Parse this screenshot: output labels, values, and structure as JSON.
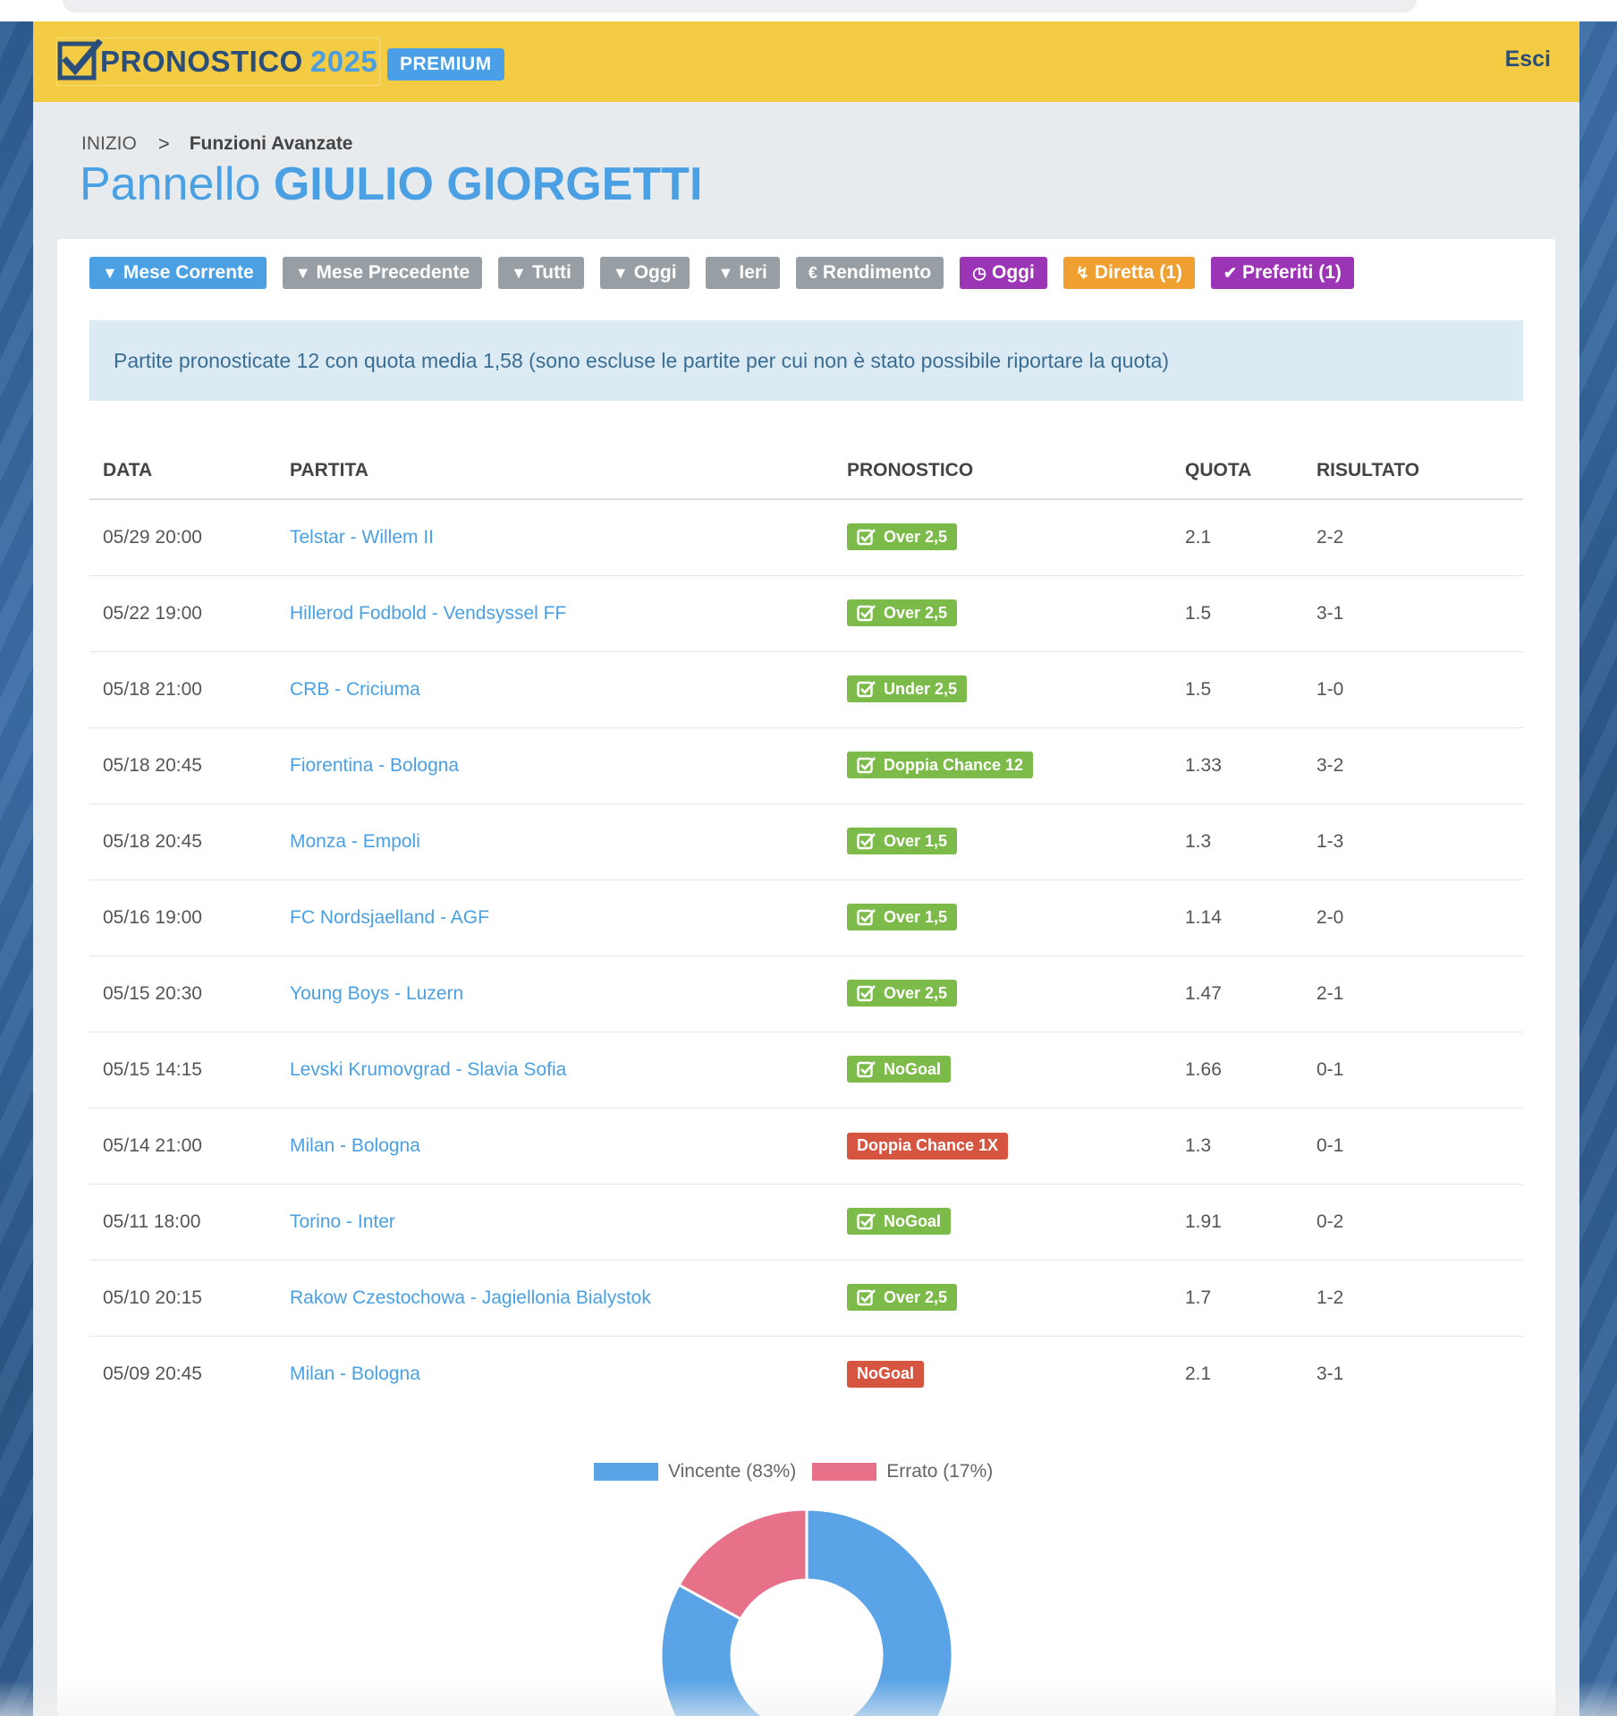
{
  "header": {
    "logo_main": "PRONOSTICO",
    "logo_year": "2025",
    "badge": "PREMIUM",
    "logout": "Esci"
  },
  "breadcrumb": {
    "home": "INIZIO",
    "separator": ">",
    "current": "Funzioni Avanzate"
  },
  "title": {
    "prefix": "Pannello",
    "name": "GIULIO GIORGETTI"
  },
  "filters": [
    {
      "label": "Mese Corrente",
      "icon": "filter-icon",
      "color": "#4aa0e3"
    },
    {
      "label": "Mese Precedente",
      "icon": "filter-icon",
      "color": "#979fa5"
    },
    {
      "label": "Tutti",
      "icon": "filter-icon",
      "color": "#979fa5"
    },
    {
      "label": "Oggi",
      "icon": "filter-icon",
      "color": "#979fa5"
    },
    {
      "label": "Ieri",
      "icon": "filter-icon",
      "color": "#979fa5"
    },
    {
      "label": "Rendimento",
      "icon": "euro-icon",
      "color": "#979fa5"
    },
    {
      "label": "Oggi",
      "icon": "clock-icon",
      "color": "#9b34b5"
    },
    {
      "label": "Diretta (1)",
      "icon": "bolt-icon",
      "color": "#f0a030"
    },
    {
      "label": "Preferiti (1)",
      "icon": "check-icon",
      "color": "#9b34b5"
    }
  ],
  "info": "Partite pronosticate 12 con quota media 1,58 (sono escluse le partite per cui non è stato possibile riportare la quota)",
  "table": {
    "headers": [
      "DATA",
      "PARTITA",
      "PRONOSTICO",
      "QUOTA",
      "RISULTATO"
    ],
    "rows": [
      {
        "date": "05/29 20:00",
        "match": "Telstar - Willem II",
        "tip": "Over 2,5",
        "status": "win",
        "odds": "2.1",
        "result": "2-2"
      },
      {
        "date": "05/22 19:00",
        "match": "Hillerod Fodbold - Vendsyssel FF",
        "tip": "Over 2,5",
        "status": "win",
        "odds": "1.5",
        "result": "3-1"
      },
      {
        "date": "05/18 21:00",
        "match": "CRB - Criciuma",
        "tip": "Under 2,5",
        "status": "win",
        "odds": "1.5",
        "result": "1-0"
      },
      {
        "date": "05/18 20:45",
        "match": "Fiorentina - Bologna",
        "tip": "Doppia Chance 12",
        "status": "win",
        "odds": "1.33",
        "result": "3-2"
      },
      {
        "date": "05/18 20:45",
        "match": "Monza - Empoli",
        "tip": "Over 1,5",
        "status": "win",
        "odds": "1.3",
        "result": "1-3"
      },
      {
        "date": "05/16 19:00",
        "match": "FC Nordsjaelland - AGF",
        "tip": "Over 1,5",
        "status": "win",
        "odds": "1.14",
        "result": "2-0"
      },
      {
        "date": "05/15 20:30",
        "match": "Young Boys - Luzern",
        "tip": "Over 2,5",
        "status": "win",
        "odds": "1.47",
        "result": "2-1"
      },
      {
        "date": "05/15 14:15",
        "match": "Levski Krumovgrad - Slavia Sofia",
        "tip": "NoGoal",
        "status": "win",
        "odds": "1.66",
        "result": "0-1"
      },
      {
        "date": "05/14 21:00",
        "match": "Milan - Bologna",
        "tip": "Doppia Chance 1X",
        "status": "lose",
        "odds": "1.3",
        "result": "0-1"
      },
      {
        "date": "05/11 18:00",
        "match": "Torino - Inter",
        "tip": "NoGoal",
        "status": "win",
        "odds": "1.91",
        "result": "0-2"
      },
      {
        "date": "05/10 20:15",
        "match": "Rakow Czestochowa - Jagiellonia Bialystok",
        "tip": "Over 2,5",
        "status": "win",
        "odds": "1.7",
        "result": "1-2"
      },
      {
        "date": "05/09 20:45",
        "match": "Milan - Bologna",
        "tip": "NoGoal",
        "status": "lose",
        "odds": "2.1",
        "result": "3-1"
      }
    ]
  },
  "chart_data": {
    "type": "pie",
    "categories": [
      "Vincente (83%)",
      "Errato (17%)"
    ],
    "values": [
      83,
      17
    ],
    "colors": [
      "#5aa3e6",
      "#e8718a"
    ],
    "legend": "top",
    "donut": true
  }
}
